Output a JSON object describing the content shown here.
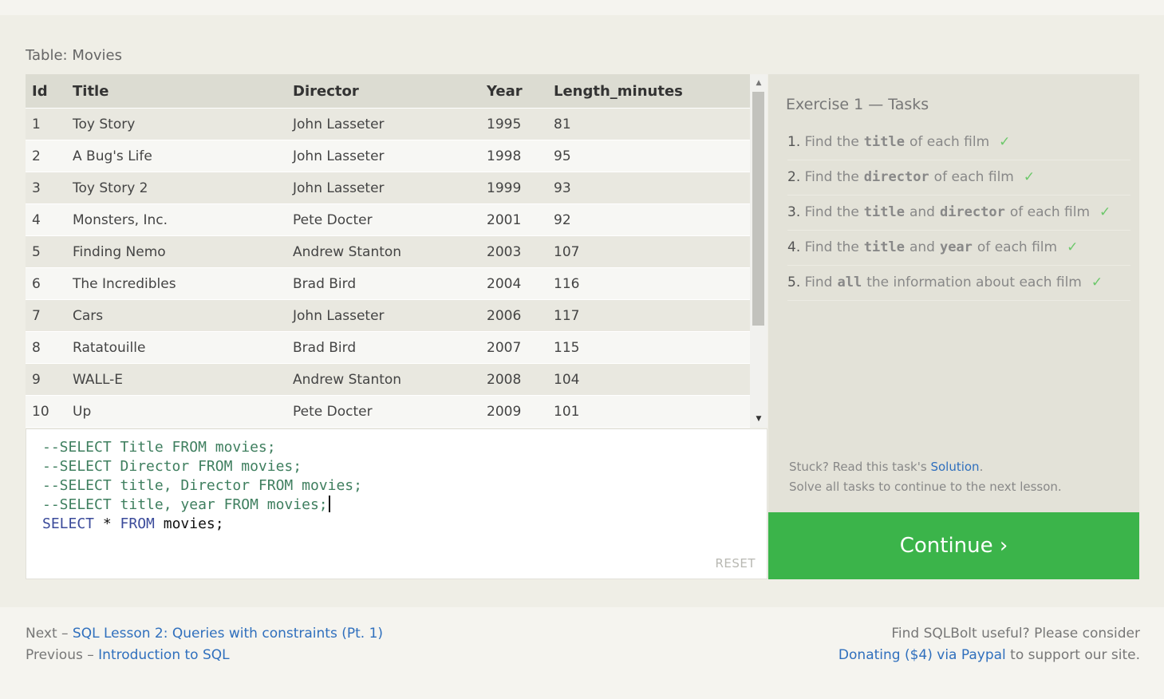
{
  "table": {
    "caption": "Table: Movies",
    "columns": [
      "Id",
      "Title",
      "Director",
      "Year",
      "Length_minutes"
    ],
    "rows": [
      [
        "1",
        "Toy Story",
        "John Lasseter",
        "1995",
        "81"
      ],
      [
        "2",
        "A Bug's Life",
        "John Lasseter",
        "1998",
        "95"
      ],
      [
        "3",
        "Toy Story 2",
        "John Lasseter",
        "1999",
        "93"
      ],
      [
        "4",
        "Monsters, Inc.",
        "Pete Docter",
        "2001",
        "92"
      ],
      [
        "5",
        "Finding Nemo",
        "Andrew Stanton",
        "2003",
        "107"
      ],
      [
        "6",
        "The Incredibles",
        "Brad Bird",
        "2004",
        "116"
      ],
      [
        "7",
        "Cars",
        "John Lasseter",
        "2006",
        "117"
      ],
      [
        "8",
        "Ratatouille",
        "Brad Bird",
        "2007",
        "115"
      ],
      [
        "9",
        "WALL-E",
        "Andrew Stanton",
        "2008",
        "104"
      ],
      [
        "10",
        "Up",
        "Pete Docter",
        "2009",
        "101"
      ]
    ],
    "scroll_up_icon": "▲",
    "scroll_down_icon": "▼"
  },
  "editor": {
    "lines": [
      {
        "type": "comment",
        "text": "--SELECT Title FROM movies;"
      },
      {
        "type": "comment",
        "text": "--SELECT Director FROM movies;"
      },
      {
        "type": "comment",
        "text": "--SELECT title, Director FROM movies;"
      },
      {
        "type": "comment",
        "text": "--SELECT title, year FROM movies;"
      }
    ],
    "active_line": {
      "kw1": "SELECT",
      "star": " * ",
      "kw2": "FROM",
      "rest": " movies;"
    },
    "reset_label": "RESET"
  },
  "tasks": {
    "title": "Exercise 1 — Tasks",
    "items": [
      {
        "num": "1.",
        "parts": [
          "Find the",
          "title",
          "of each film"
        ]
      },
      {
        "num": "2.",
        "parts": [
          "Find the",
          "director",
          "of each film"
        ]
      },
      {
        "num": "3.",
        "parts": [
          "Find the",
          "title",
          "and",
          "director",
          "of each film"
        ]
      },
      {
        "num": "4.",
        "parts": [
          "Find the",
          "title",
          "and",
          "year",
          "of each film"
        ]
      },
      {
        "num": "5.",
        "parts": [
          "Find",
          "all",
          "the information about each film"
        ]
      }
    ],
    "check": "✓",
    "stuck_prefix": "Stuck? Read this task's ",
    "solution_link": "Solution",
    "stuck_suffix": ".",
    "solve_note": "Solve all tasks to continue to the next lesson.",
    "continue_label": "Continue ›"
  },
  "footer": {
    "next_prefix": "Next – ",
    "next_link": "SQL Lesson 2: Queries with constraints (Pt. 1)",
    "previous_prefix": "Previous – ",
    "previous_link": "Introduction to SQL",
    "donate_line1": "Find SQLBolt useful? Please consider",
    "donate_link": "Donating ($4) via Paypal",
    "donate_suffix": " to support our site."
  },
  "colors": {
    "accent_green": "#3bb44a",
    "link_blue": "#2f6fbd",
    "check_green": "#6cc86a"
  }
}
